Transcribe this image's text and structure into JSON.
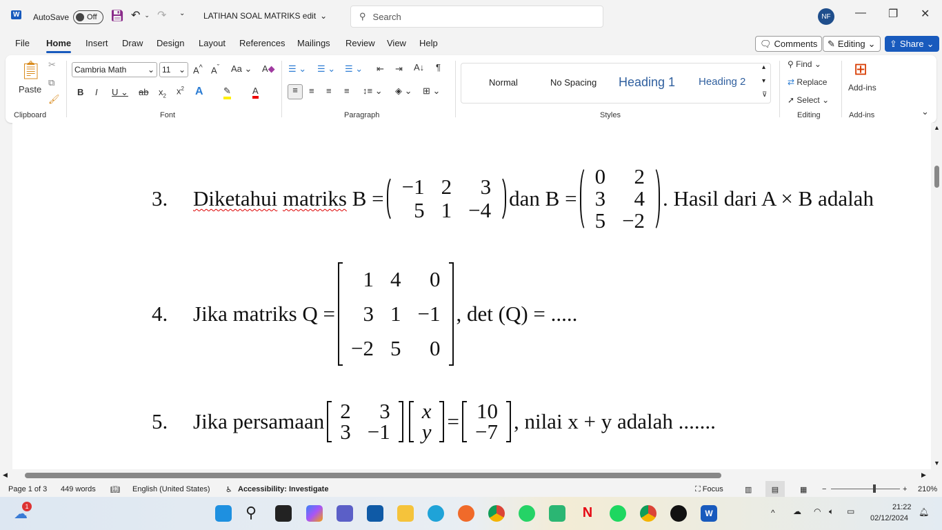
{
  "titlebar": {
    "autosave": "AutoSave",
    "autosave_state": "Off",
    "doc_title": "LATIHAN SOAL MATRIKS edit",
    "search_placeholder": "Search",
    "user_initials": "NF"
  },
  "tabs": [
    "File",
    "Home",
    "Insert",
    "Draw",
    "Design",
    "Layout",
    "References",
    "Mailings",
    "Review",
    "View",
    "Help"
  ],
  "actions": {
    "comments": "Comments",
    "editing": "Editing",
    "share": "Share"
  },
  "ribbon": {
    "paste": "Paste",
    "font_name": "Cambria Math",
    "font_size": "11",
    "styles": [
      "Normal",
      "No Spacing",
      "Heading 1",
      "Heading 2"
    ],
    "find": "Find",
    "replace": "Replace",
    "select": "Select",
    "addins": "Add-ins",
    "groups": [
      "Clipboard",
      "Font",
      "Paragraph",
      "Styles",
      "Editing",
      "Add-ins"
    ]
  },
  "document": {
    "q3": {
      "num": "3.",
      "pre": "Diketahui",
      "word2": "matriks",
      "t1": "B =",
      "m1": [
        [
          "−1",
          "2",
          "3"
        ],
        [
          "5",
          "1",
          "−4"
        ]
      ],
      "t2": "dan B =",
      "m2": [
        [
          "0",
          "2"
        ],
        [
          "3",
          "4"
        ],
        [
          "5",
          "−2"
        ]
      ],
      "t3": ". Hasil dari A × B adalah"
    },
    "q4": {
      "num": "4.",
      "t1": "Jika matriks Q =",
      "m1": [
        [
          "1",
          "4",
          "0"
        ],
        [
          "3",
          "1",
          "−1"
        ],
        [
          "−2",
          "5",
          "0"
        ]
      ],
      "t2": ", det (Q) = ....."
    },
    "q5": {
      "num": "5.",
      "t1": "Jika persamaan",
      "m1": [
        [
          "2",
          "3"
        ],
        [
          "3",
          "−1"
        ]
      ],
      "m2": [
        [
          "x"
        ],
        [
          "y"
        ]
      ],
      "t2": "=",
      "m3": [
        [
          "10"
        ],
        [
          "−7"
        ]
      ],
      "t3": ", nilai x + y  adalah ......."
    }
  },
  "status": {
    "page": "Page 1 of 3",
    "words": "449 words",
    "language": "English (United States)",
    "accessibility": "Accessibility: Investigate",
    "focus": "Focus",
    "zoom": "210%"
  },
  "taskbar": {
    "time": "21:22",
    "date": "02/12/2024",
    "badge": "1"
  }
}
